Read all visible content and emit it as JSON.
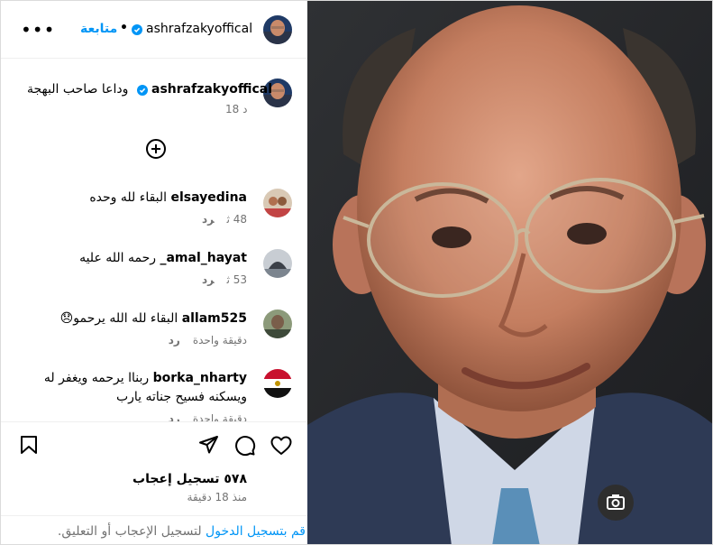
{
  "header": {
    "more_label": "•••",
    "follow_label": "متابعة",
    "separator": "•",
    "username": "ashrafzakyoffical"
  },
  "caption": {
    "username": "ashrafzakyoffical",
    "text": "وداعا صاحب البهجة",
    "time": "18 د"
  },
  "comments": [
    {
      "username": "elsayedina",
      "text": "البقاء لله وحده",
      "time": "48 ث",
      "reply": "رد"
    },
    {
      "username": "amal_hayat_",
      "text": "رحمه الله عليه",
      "time": "53 ث",
      "reply": "رد"
    },
    {
      "username": "allam525",
      "text": "البقاء لله الله يرحمو😞",
      "time": "دقيقة واحدة",
      "reply": "رد"
    },
    {
      "username": "borka_nharty",
      "text": "ربنا‌ا يرحمه ويغفر له",
      "text2": "ويسكنه فسيح جناته يارب",
      "time": "دقيقة واحدة",
      "reply": "رد"
    }
  ],
  "actions": {
    "likes": "٥٧٨ تسجيل إعجاب",
    "since": "منذ 18 دقيقة"
  },
  "footer": {
    "login_link": "قم بتسجيل الدخول",
    "rest": " لتسجيل الإعجاب أو التعليق."
  },
  "colors": {
    "link": "#0095f6",
    "muted": "#737373",
    "verified": "#0095f6"
  },
  "icons": [
    "more-icon",
    "verified-icon",
    "add-icon",
    "bookmark-icon",
    "share-icon",
    "comment-icon",
    "like-icon",
    "camera-icon"
  ]
}
